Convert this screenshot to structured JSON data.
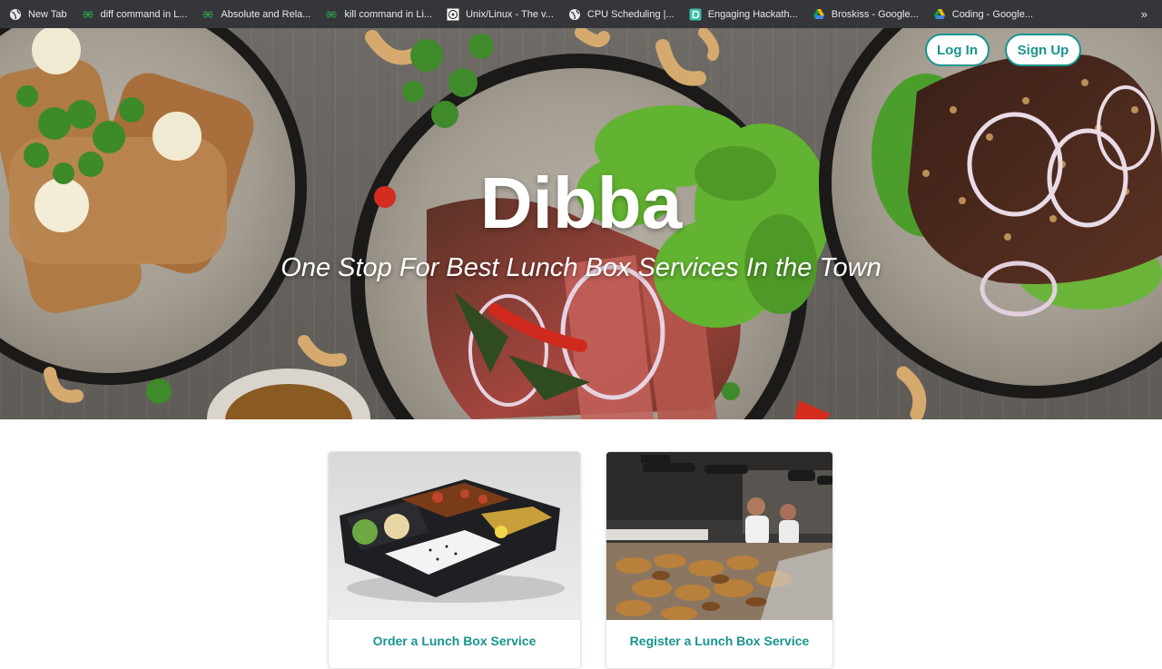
{
  "bookmarks": [
    {
      "label": "New Tab",
      "icon": "globe-icon"
    },
    {
      "label": "diff command in L...",
      "icon": "geeksforgeeks-icon"
    },
    {
      "label": "Absolute and Rela...",
      "icon": "geeksforgeeks-icon"
    },
    {
      "label": "kill command in Li...",
      "icon": "geeksforgeeks-icon"
    },
    {
      "label": "Unix/Linux - The v...",
      "icon": "site-icon"
    },
    {
      "label": "CPU Scheduling |...",
      "icon": "globe-icon"
    },
    {
      "label": "Engaging Hackath...",
      "icon": "devfolio-icon"
    },
    {
      "label": "Broskiss - Google...",
      "icon": "google-drive-icon"
    },
    {
      "label": "Coding - Google...",
      "icon": "google-drive-icon"
    }
  ],
  "bookmarks_overflow": "»",
  "hero": {
    "brand": "Dibba",
    "tagline": "One Stop For Best Lunch Box Services In the Town"
  },
  "auth": {
    "login_label": "Log In",
    "signup_label": "Sign Up"
  },
  "cards": {
    "order": {
      "caption": "Order a Lunch Box Service",
      "image": "lunch-box-tray-image"
    },
    "register": {
      "caption": "Register a Lunch Box Service",
      "image": "bakery-counter-image"
    }
  },
  "colors": {
    "accent": "#17948f",
    "bookmarks_bar": "#35363a",
    "hero_wood": "#6b6763"
  }
}
